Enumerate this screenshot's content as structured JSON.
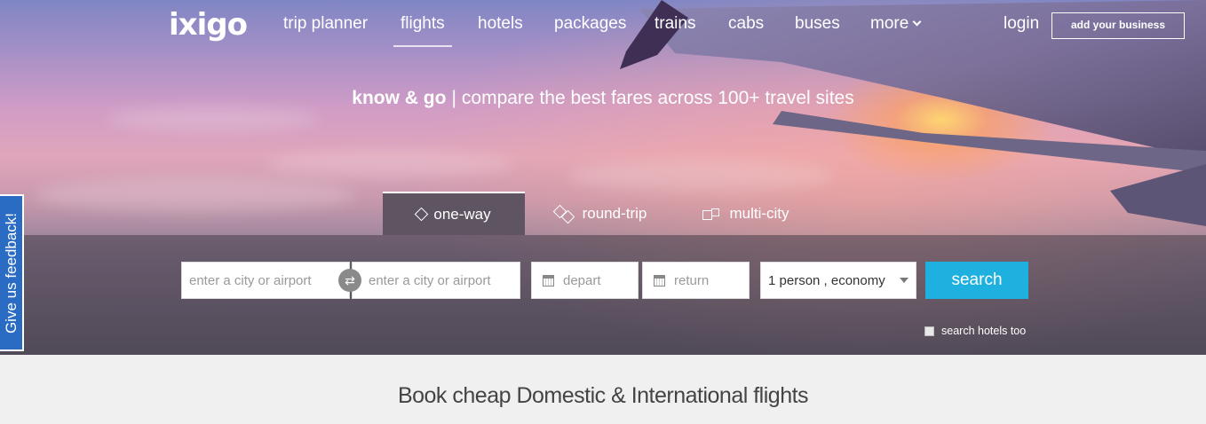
{
  "brand": {
    "logo": "ixigo"
  },
  "nav": {
    "items": [
      {
        "label": "trip planner"
      },
      {
        "label": "flights",
        "active": true
      },
      {
        "label": "hotels"
      },
      {
        "label": "packages"
      },
      {
        "label": "trains"
      },
      {
        "label": "cabs"
      },
      {
        "label": "buses"
      },
      {
        "label": "more"
      }
    ],
    "login": "login",
    "add_business": "add your business"
  },
  "hero": {
    "tagline_bold": "know & go",
    "tagline_sep": "|",
    "tagline_rest": "compare the best fares across 100+ travel sites"
  },
  "tabs": [
    {
      "label": "one-way",
      "active": true,
      "icon": "diamond-icon"
    },
    {
      "label": "round-trip",
      "icon": "double-diamond-icon"
    },
    {
      "label": "multi-city",
      "icon": "multi-square-icon"
    }
  ],
  "search": {
    "from_placeholder": "enter a city or airport",
    "to_placeholder": "enter a city or airport",
    "depart": "depart",
    "return": "return",
    "travellers": "1 person , economy",
    "button": "search",
    "hotels_too": "search hotels too"
  },
  "feedback": "Give us feedback!",
  "section": {
    "title": "Book cheap Domestic & International flights"
  },
  "colors": {
    "accent": "#1eb1e0",
    "feedback": "#2a6cc4"
  }
}
